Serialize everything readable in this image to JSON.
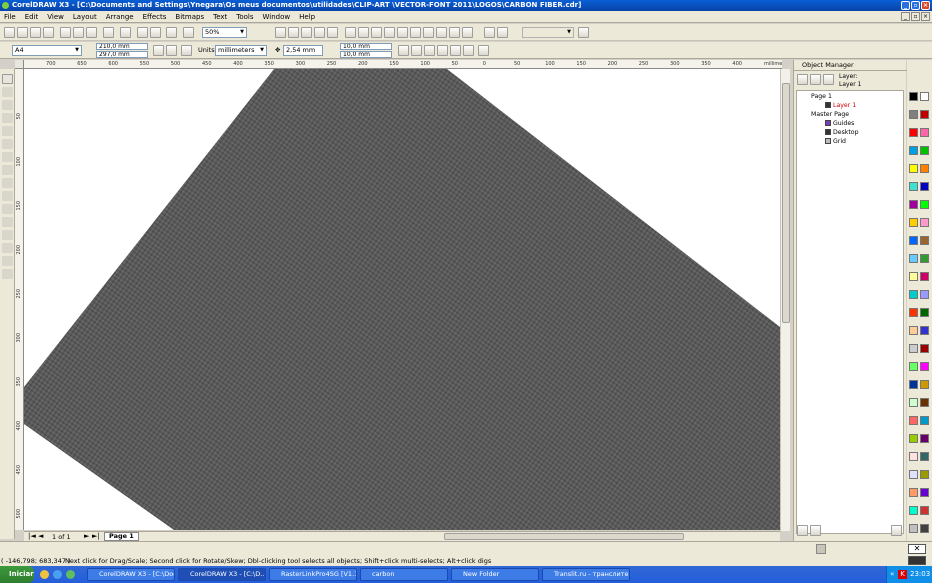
{
  "window": {
    "title": "CorelDRAW X3 - [C:\\Documents and Settings\\Ynegara\\Os meus documentos\\utilidades\\CLIP-ART \\VECTOR-FONT 2011\\LOGOS\\CARBON FIBER.cdr]"
  },
  "menu": [
    "File",
    "Edit",
    "View",
    "Layout",
    "Arrange",
    "Effects",
    "Bitmaps",
    "Text",
    "Tools",
    "Window",
    "Help"
  ],
  "toolbar": {
    "zoom": "50%"
  },
  "property_bar": {
    "paper": "A4",
    "width": "210,0 mm",
    "height": "297,0 mm",
    "units_label": "Units:",
    "units": "millimeters",
    "nudge": "2,54 mm",
    "dup_x": "10,0 mm",
    "dup_y": "10,0 mm"
  },
  "ruler": {
    "unit": "millimeters",
    "h_ticks": [
      "700",
      "650",
      "600",
      "550",
      "500",
      "450",
      "400",
      "350",
      "300",
      "250",
      "200",
      "150",
      "100",
      "50",
      "0",
      "50",
      "100",
      "150",
      "200",
      "250",
      "300",
      "350",
      "400"
    ],
    "v_ticks": [
      "500",
      "450",
      "400",
      "350",
      "300",
      "250",
      "200",
      "150",
      "100",
      "50"
    ]
  },
  "page_nav": {
    "count": "1 of 1",
    "tab": "Page 1"
  },
  "docker": {
    "title": "Object Manager",
    "layer_label": "Layer:",
    "layer_name": "Layer 1",
    "tree": [
      {
        "label": "Page 1",
        "swatch": ""
      },
      {
        "label": "Layer 1",
        "swatch": "#333333"
      },
      {
        "label": "Master Page",
        "swatch": ""
      },
      {
        "label": "Guides",
        "swatch": "#7a3fb0"
      },
      {
        "label": "Desktop",
        "swatch": "#333333"
      },
      {
        "label": "Grid",
        "swatch": "#bbbbbb"
      }
    ]
  },
  "palette_colors": [
    "#000000",
    "#ffffff",
    "#808080",
    "#c00000",
    "#ff0000",
    "#ff66aa",
    "#00a0e0",
    "#00c000",
    "#ffff00",
    "#ff8000",
    "#40e0d0",
    "#0000c0",
    "#a000a0",
    "#00ff00",
    "#ffcc00",
    "#ff99cc",
    "#0066ff",
    "#996633",
    "#66ccff",
    "#339933",
    "#ffff99",
    "#cc0066",
    "#00cccc",
    "#9999ff",
    "#ff3300",
    "#006600",
    "#ffcc99",
    "#3333cc",
    "#cccccc",
    "#990000",
    "#66ff66",
    "#ff00ff",
    "#003399",
    "#cc9900",
    "#ccffcc",
    "#663300",
    "#ff6666",
    "#0099cc",
    "#99cc00",
    "#660066",
    "#ffe0e0",
    "#336666",
    "#e0e0ff",
    "#999900",
    "#ff9966",
    "#6600cc",
    "#00ffcc",
    "#cc3333",
    "#c0c0c0",
    "#404040"
  ],
  "status": {
    "coords": "( -146,798; 683,347 )",
    "hint": "Next click for Drag/Scale; Second click for Rotate/Skew; Dbl-clicking tool selects all objects; Shift+click multi-selects; Alt+click digs"
  },
  "taskbar": {
    "start": "Iniciar",
    "tasks": [
      "CorelDRAW X3 - [C:\\Doc...",
      "CorelDRAW X3 - [C:\\D...",
      "RasterLinkPro4SG [V1.10]",
      "carbon",
      "New Folder",
      "Translit.ru - транслитер..."
    ],
    "clock": "23:03"
  },
  "colors": {
    "carbon": "#5a5a5a",
    "title_bar": "#0a5fd6"
  }
}
